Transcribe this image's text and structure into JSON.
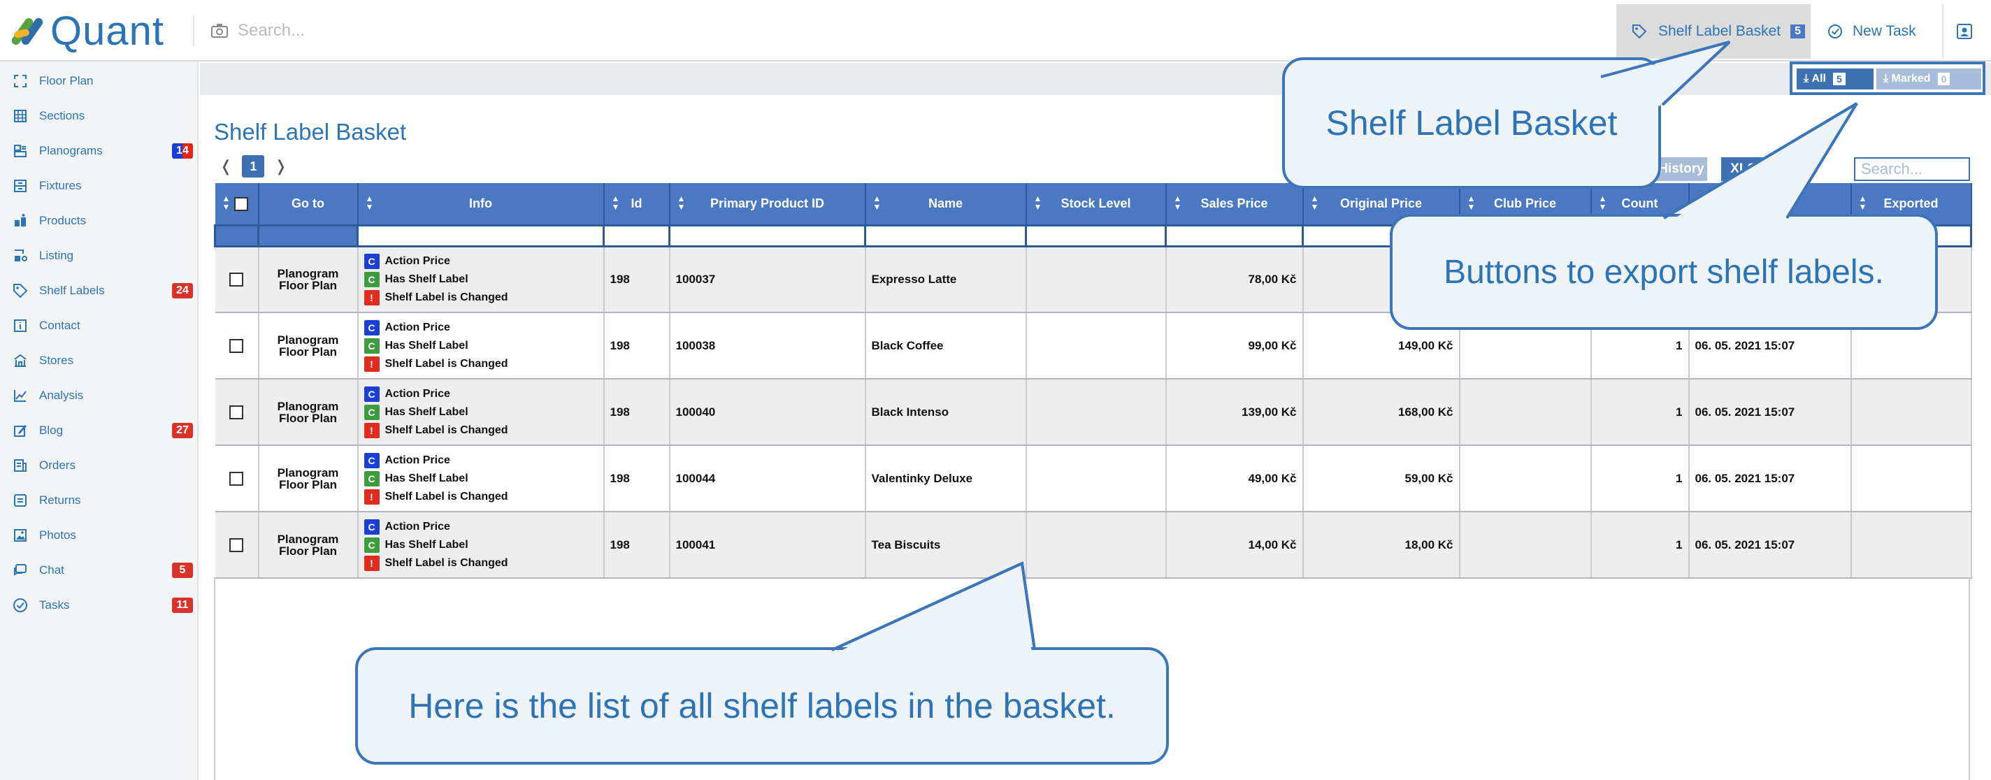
{
  "app": {
    "name": "Quant"
  },
  "search": {
    "placeholder": "Search..."
  },
  "topbar": {
    "basket_label": "Shelf Label Basket",
    "basket_count": "5",
    "new_task_label": "New Task"
  },
  "sidebar": {
    "items": [
      {
        "label": "Floor Plan",
        "icon": "floor-plan-icon",
        "badge": ""
      },
      {
        "label": "Sections",
        "icon": "sections-icon",
        "badge": ""
      },
      {
        "label": "Planograms",
        "icon": "planograms-icon",
        "badge": "14"
      },
      {
        "label": "Fixtures",
        "icon": "fixtures-icon",
        "badge": ""
      },
      {
        "label": "Products",
        "icon": "products-icon",
        "badge": ""
      },
      {
        "label": "Listing",
        "icon": "listing-icon",
        "badge": ""
      },
      {
        "label": "Shelf Labels",
        "icon": "tag-icon",
        "badge": "24"
      },
      {
        "label": "Contact",
        "icon": "contact-icon",
        "badge": ""
      },
      {
        "label": "Stores",
        "icon": "stores-icon",
        "badge": ""
      },
      {
        "label": "Analysis",
        "icon": "analysis-icon",
        "badge": ""
      },
      {
        "label": "Blog",
        "icon": "blog-icon",
        "badge": "27"
      },
      {
        "label": "Orders",
        "icon": "orders-icon",
        "badge": ""
      },
      {
        "label": "Returns",
        "icon": "returns-icon",
        "badge": ""
      },
      {
        "label": "Photos",
        "icon": "photos-icon",
        "badge": ""
      },
      {
        "label": "Chat",
        "icon": "chat-icon",
        "badge": "5"
      },
      {
        "label": "Tasks",
        "icon": "tasks-icon",
        "badge": "11"
      }
    ],
    "badge_colors": {
      "planograms": "#e0261b",
      "default": "#d9342b"
    }
  },
  "export": {
    "all_label": "All",
    "all_count": "5",
    "marked_label": "Marked",
    "marked_count": "0"
  },
  "page": {
    "title": "Shelf Label Basket",
    "pager": {
      "prev": "❬",
      "current": "1",
      "next": "❭"
    },
    "history_label": "History",
    "xlsx_label": "XLSX",
    "table_search_placeholder": "Search..."
  },
  "table": {
    "columns": [
      "Go to",
      "Info",
      "Id",
      "Primary Product ID",
      "Name",
      "Stock Level",
      "Sales Price",
      "Original Price",
      "Club Price",
      "Count",
      "",
      "Exported"
    ],
    "rows": [
      {
        "goto": [
          "Planogram",
          "Floor Plan"
        ],
        "info": [
          "Action Price",
          "Has Shelf Label",
          "Shelf Label is Changed"
        ],
        "id": "198",
        "product_id": "100037",
        "name": "Expresso Latte",
        "stock": "",
        "sales_price": "78,00 Kč",
        "original_price": "",
        "club_price": "",
        "count": "",
        "date": "",
        "exported": ""
      },
      {
        "goto": [
          "Planogram",
          "Floor Plan"
        ],
        "info": [
          "Action Price",
          "Has Shelf Label",
          "Shelf Label is Changed"
        ],
        "id": "198",
        "product_id": "100038",
        "name": "Black Coffee",
        "stock": "",
        "sales_price": "99,00 Kč",
        "original_price": "149,00 Kč",
        "club_price": "",
        "count": "1",
        "date": "06. 05. 2021 15:07",
        "exported": ""
      },
      {
        "goto": [
          "Planogram",
          "Floor Plan"
        ],
        "info": [
          "Action Price",
          "Has Shelf Label",
          "Shelf Label is Changed"
        ],
        "id": "198",
        "product_id": "100040",
        "name": "Black Intenso",
        "stock": "",
        "sales_price": "139,00 Kč",
        "original_price": "168,00 Kč",
        "club_price": "",
        "count": "1",
        "date": "06. 05. 2021 15:07",
        "exported": ""
      },
      {
        "goto": [
          "Planogram",
          "Floor Plan"
        ],
        "info": [
          "Action Price",
          "Has Shelf Label",
          "Shelf Label is Changed"
        ],
        "id": "198",
        "product_id": "100044",
        "name": "Valentinky Deluxe",
        "stock": "",
        "sales_price": "49,00 Kč",
        "original_price": "59,00 Kč",
        "club_price": "",
        "count": "1",
        "date": "06. 05. 2021 15:07",
        "exported": ""
      },
      {
        "goto": [
          "Planogram",
          "Floor Plan"
        ],
        "info": [
          "Action Price",
          "Has Shelf Label",
          "Shelf Label is Changed"
        ],
        "id": "198",
        "product_id": "100041",
        "name": "Tea Biscuits",
        "stock": "",
        "sales_price": "14,00 Kč",
        "original_price": "18,00 Kč",
        "club_price": "",
        "count": "1",
        "date": "06. 05. 2021 15:07",
        "exported": ""
      }
    ],
    "info_tag_letters": [
      "C",
      "C",
      "!"
    ]
  },
  "callouts": {
    "basket": "Shelf Label Basket",
    "export": "Buttons to export shelf labels.",
    "list": "Here is the list of all shelf labels in the basket."
  },
  "colors": {
    "brand": "#2d74b4",
    "header": "#4a78c3",
    "badge": "#d9342b"
  }
}
